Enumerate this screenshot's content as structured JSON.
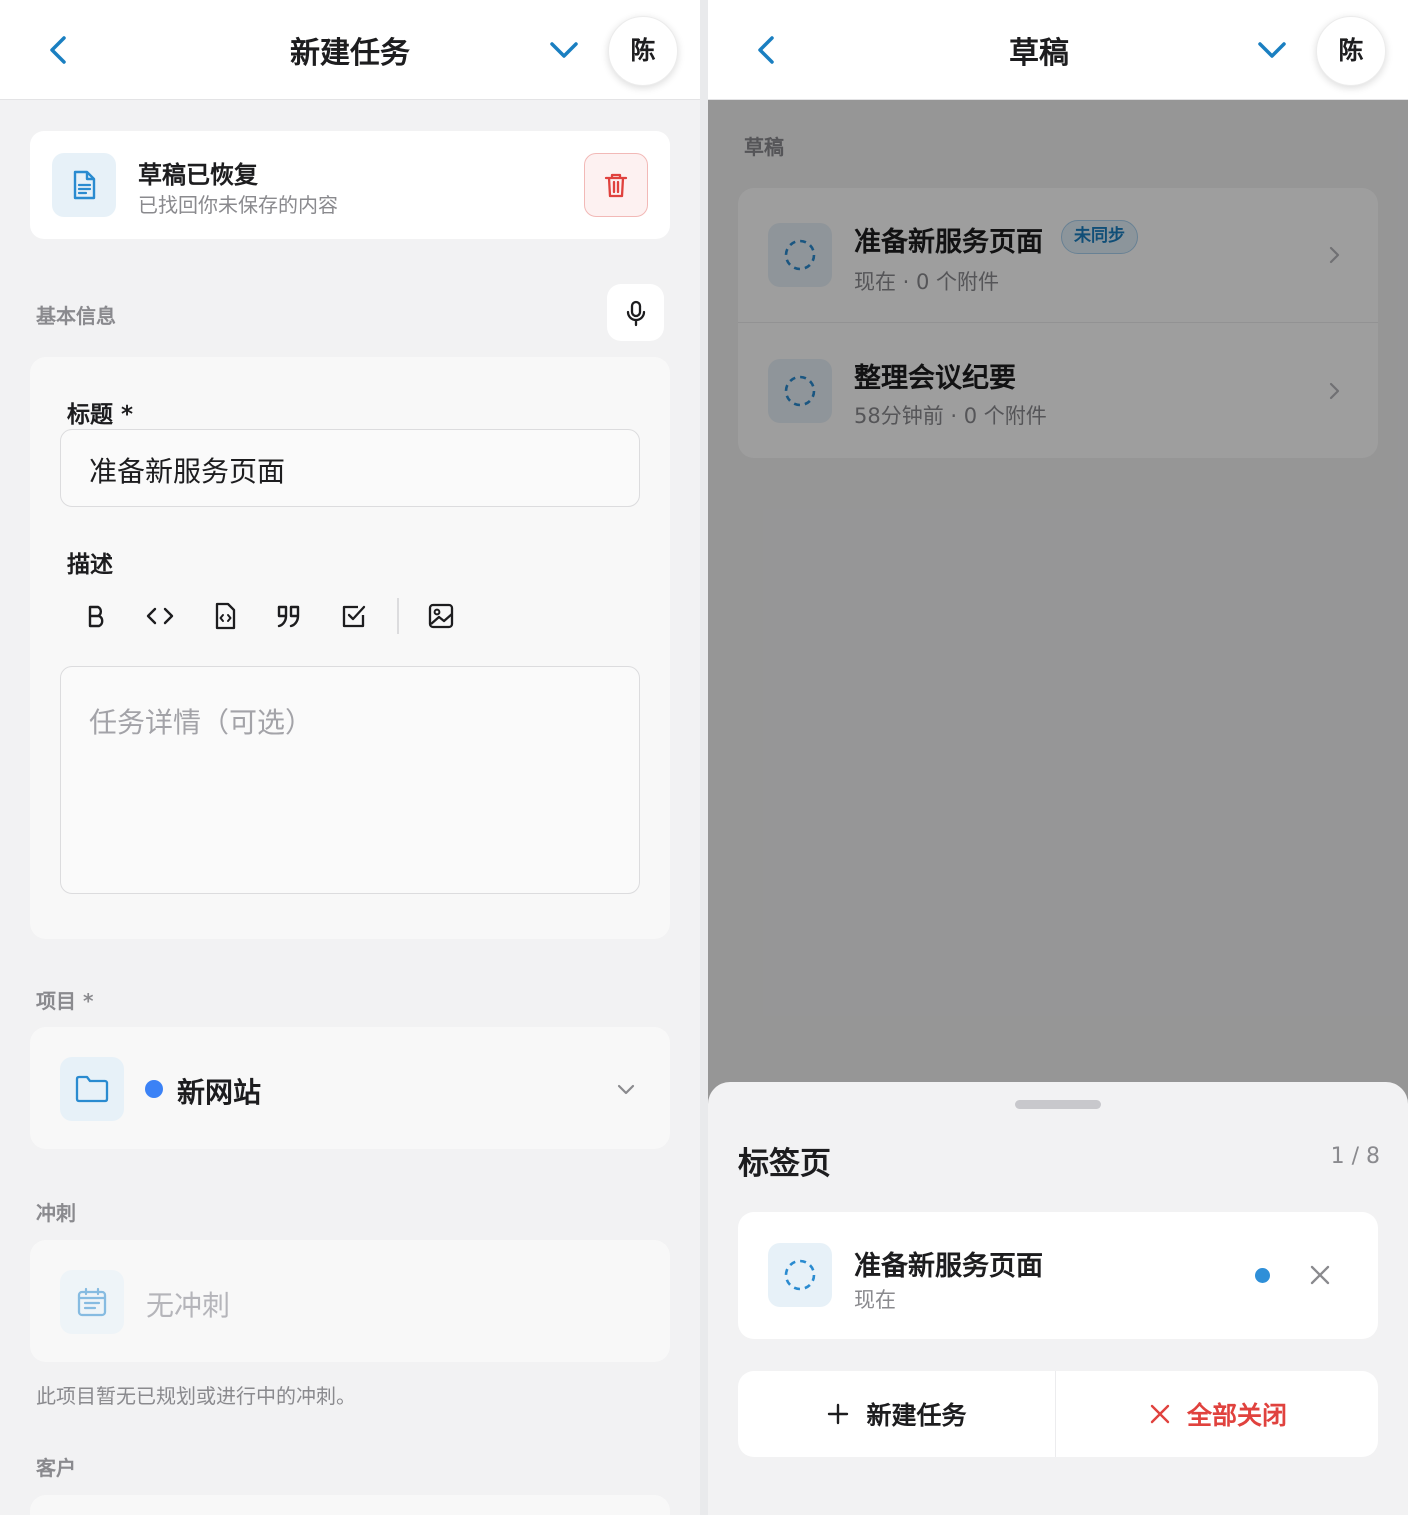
{
  "left": {
    "header": {
      "title": "新建任务",
      "avatar": "陈"
    },
    "draft_banner": {
      "title": "草稿已恢复",
      "subtitle": "已找回你未保存的内容"
    },
    "basic_info": {
      "label": "基本信息",
      "title_label": "标题 *",
      "title_value": "准备新服务页面",
      "desc_label": "描述",
      "desc_placeholder": "任务详情（可选）",
      "toolbar": [
        "bold-icon",
        "code-icon",
        "code-file-icon",
        "quote-icon",
        "checkbox-icon",
        "image-icon"
      ]
    },
    "project": {
      "label": "项目 *",
      "value": "新网站",
      "dot_color": "#3b82f6"
    },
    "sprint": {
      "label": "冲刺",
      "value": "无冲刺",
      "hint": "此项目暂无已规划或进行中的冲刺。"
    },
    "client": {
      "label": "客户"
    }
  },
  "right": {
    "header": {
      "title": "草稿",
      "avatar": "陈"
    },
    "drafts": {
      "label": "草稿",
      "items": [
        {
          "title": "准备新服务页面",
          "badge": "未同步",
          "meta": "现在 · 0 个附件"
        },
        {
          "title": "整理会议纪要",
          "meta": "58分钟前 · 0 个附件"
        }
      ]
    },
    "tabs_sheet": {
      "title": "标签页",
      "counter": "1 / 8",
      "tab": {
        "title": "准备新服务页面",
        "meta": "现在"
      },
      "new_task_label": "新建任务",
      "close_all_label": "全部关闭"
    }
  },
  "colors": {
    "accent": "#1a7fc1",
    "danger": "#e0423e",
    "active_dot": "#2f8fd8"
  }
}
